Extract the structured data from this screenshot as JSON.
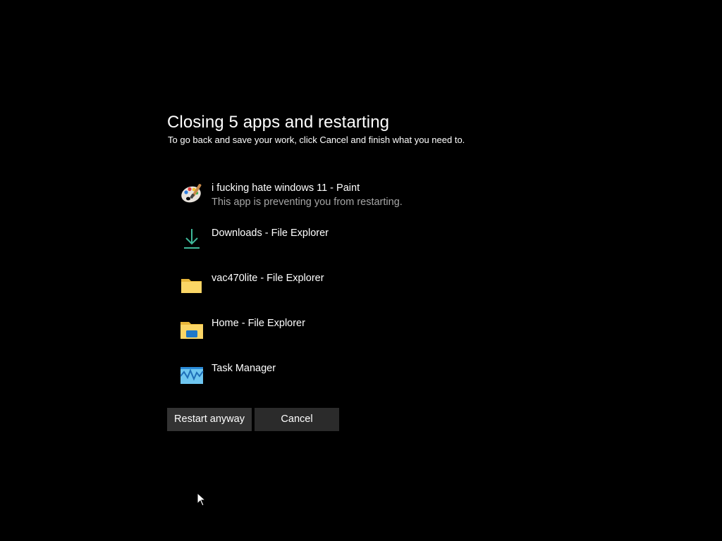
{
  "dialog": {
    "title": "Closing 5 apps and restarting",
    "subtitle": "To go back and save your work, click Cancel and finish what you need to."
  },
  "apps": [
    {
      "name": "i fucking hate windows 11 - Paint",
      "status": "This app is preventing you from restarting.",
      "icon": "paint-palette-icon"
    },
    {
      "name": "Downloads - File Explorer",
      "status": "",
      "icon": "download-arrow-icon"
    },
    {
      "name": "vac470lite - File Explorer",
      "status": "",
      "icon": "folder-icon"
    },
    {
      "name": "Home - File Explorer",
      "status": "",
      "icon": "home-folder-icon"
    },
    {
      "name": "Task Manager",
      "status": "",
      "icon": "task-manager-icon"
    }
  ],
  "buttons": {
    "restart_label": "Restart anyway",
    "cancel_label": "Cancel"
  },
  "colors": {
    "background": "#000000",
    "button": "#333333",
    "secondary_text": "#a6a6a6"
  }
}
